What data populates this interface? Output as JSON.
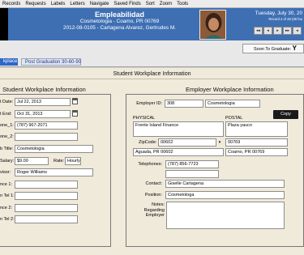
{
  "menubar": [
    "Records",
    "Requests",
    "Labels",
    "Letters",
    "Navigate",
    "Saved Finds",
    "Sort",
    "Zoom",
    "Tools"
  ],
  "header": {
    "name": "Empleabilidad",
    "program_line": "Cosmetologia  -  Coamo, PR 00769",
    "record_line": "2012-08-0105 - Cartagena Alvarez, Gertrudes M.",
    "date": "Tuesday, July 30, 20",
    "record_count": "Record 4 of 48 (48 fou",
    "nav_buttons": [
      "◂◂",
      "◂",
      "▸",
      "▸▸",
      "◂",
      "▸"
    ]
  },
  "tabs": {
    "active": "kplace",
    "post_graduation": "Post Graduation 30-60-90"
  },
  "soon_to_graduate": {
    "label": "Soon To Graduate:",
    "value": "Y"
  },
  "section_title": "Student Workplace Information",
  "student_panel": {
    "title": "Student Workplace Information",
    "rows": [
      {
        "label": "t Date:",
        "value": "Jul 22, 2013"
      },
      {
        "label": "t End:",
        "value": "Oct 31, 2013"
      },
      {
        "label": "one_1:",
        "value": "(787) 967-2071"
      },
      {
        "label": "one_2:",
        "value": ""
      },
      {
        "label": "b Title:",
        "value": "Cosmetologia"
      },
      {
        "label": "Salary:",
        "value": "$9.00"
      },
      {
        "label": "visor:",
        "value": "Roger Williams"
      },
      {
        "label": "nce 1:",
        "value": ""
      },
      {
        "label": "n Tel 1:",
        "value": ""
      },
      {
        "label": "nce 2:",
        "value": ""
      },
      {
        "label": "n Tel 2:",
        "value": ""
      }
    ],
    "rate": {
      "label": "Rate:",
      "value": "Hourly"
    }
  },
  "employer_panel": {
    "title": "Employer Workplace Information",
    "employer_id_label": "Employer ID:",
    "employer_id": "308",
    "employer_name": "Cosmetologia",
    "copy_label": "Copy",
    "physical": {
      "heading": "PHYSICAL",
      "address": "Frente Island Finance",
      "zip_label": "ZipCode:",
      "zip": "00602",
      "city_line": "Aguada, PR 00602"
    },
    "postal": {
      "heading": "POSTAL",
      "address": "Plaza yauco",
      "zip": "00769",
      "city_line": "Coamo, PR 00769"
    },
    "telephones_label": "Telephones:",
    "telephone": "(787) 856-7723",
    "contact_label": "Contact:",
    "contact": "Giselle Cartagena",
    "position_label": "Position:",
    "position": "Cosmetologa",
    "notes_label": "Notes:\nRegarding\nEmployer"
  },
  "colors": {
    "header_blue": "#3e6fb3",
    "tab_blue": "#2f67c9",
    "panel_bg": "#f0eadb"
  }
}
